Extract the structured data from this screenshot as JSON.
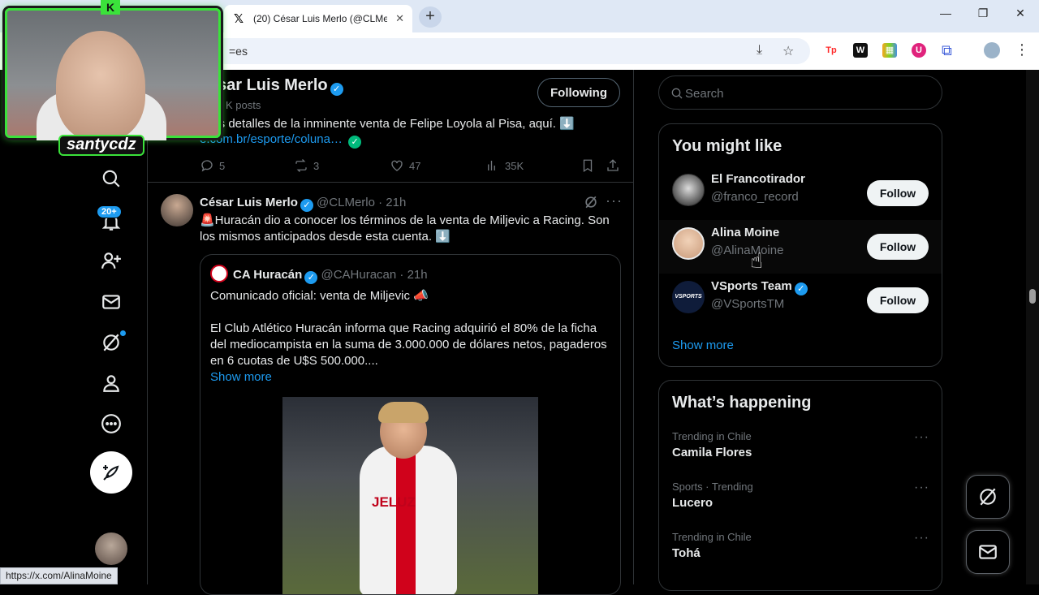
{
  "browser": {
    "tab_title": "(20) César Luis Merlo (@CLMerlo",
    "tab_close": "✕",
    "new_tab": "+",
    "url": "=es",
    "status_url": "https://x.com/AlinaMoine",
    "window_controls": [
      "—",
      "❐",
      "✕"
    ],
    "extensions": [
      {
        "label": "Tp",
        "color": "#ff2a2a"
      },
      {
        "label": "W",
        "color": "#111111"
      },
      {
        "label": "▦",
        "color": "#f5a623"
      },
      {
        "label": "U",
        "color": "#e0237c"
      }
    ]
  },
  "overlay": {
    "streamer_name": "santycdz",
    "logo": "K"
  },
  "nav": {
    "notif_count": "20+"
  },
  "profile": {
    "name": "sar Luis Merlo",
    "posts": "K posts",
    "following_label": "Following"
  },
  "tweet1": {
    "text": "lás detalles de la inminente venta de Felipe Loyola al Pisa, aquí. ⬇️",
    "link": "e.com.br/esporte/coluna…",
    "replies": "5",
    "retweets": "3",
    "likes": "47",
    "views": "35K"
  },
  "tweet2": {
    "author": "César Luis Merlo",
    "handle": "@CLMerlo · 21h",
    "text_line1": "🚨Huracán dio a conocer los términos de la venta de Miljevic a Racing. Son",
    "text_line2": "los mismos anticipados desde esta cuenta. ⬇️",
    "quote": {
      "author": "CA Huracán",
      "handle": "@CAHuracan · 21h",
      "line1": "Comunicado oficial: venta de Miljevic 📣",
      "line2": "El Club Atlético Huracán informa que Racing adquirió el 80% de la ficha",
      "line3": "del mediocampista en la suma de 3.000.000 de dólares netos, pagaderos",
      "line4": "en 6 cuotas de U$S 500.000....",
      "show_more": "Show more",
      "sponsor": "JELUZ"
    }
  },
  "search": {
    "placeholder": "Search"
  },
  "suggestions": {
    "title": "You might like",
    "follow_label": "Follow",
    "show_more": "Show more",
    "items": [
      {
        "name": "El Francotirador",
        "handle": "@franco_record"
      },
      {
        "name": "Alina Moine",
        "handle": "@AlinaMoine"
      },
      {
        "name": "VSports Team",
        "handle": "@VSportsTM",
        "avatar_text": "VSPORTS"
      }
    ]
  },
  "trends": {
    "title": "What’s happening",
    "items": [
      {
        "meta": "Trending in Chile",
        "name": "Camila Flores"
      },
      {
        "meta": "Sports · Trending",
        "name": "Lucero"
      },
      {
        "meta": "Trending in Chile",
        "name": "Tohá"
      }
    ],
    "more": "···"
  }
}
